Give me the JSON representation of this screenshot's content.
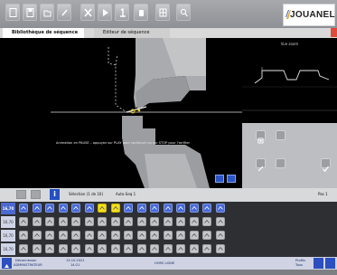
{
  "toolbar": {
    "buttons": [
      {
        "name": "file-icon"
      },
      {
        "name": "save-icon"
      },
      {
        "name": "folder-icon"
      },
      {
        "name": "edit-icon"
      },
      {
        "name": "delete-icon"
      },
      {
        "name": "play-icon"
      },
      {
        "name": "step-icon"
      },
      {
        "name": "hand-icon"
      },
      {
        "name": "table-icon"
      },
      {
        "name": "zoom-icon"
      }
    ],
    "brand": "JOUANEL"
  },
  "tabs": [
    {
      "label": "Bibliothèque de séquence"
    },
    {
      "label": "Editeur de séquence"
    }
  ],
  "zoom_panel": {
    "title": "Vue zoom"
  },
  "status_message": "Animation en PAUSE – appuyez sur PLAY pour continuer ou sur STOP pour l'arrêter",
  "selection_bar": {
    "selection": "Sélection (1 de 16)",
    "program": "Auto-Seq 1",
    "page": "Pas 1"
  },
  "grid": {
    "rows": [
      {
        "label": "16,70",
        "active": true
      },
      {
        "label": "16,70",
        "active": false
      },
      {
        "label": "16,70",
        "active": false
      },
      {
        "label": "16,70",
        "active": false
      }
    ],
    "highlighted": [
      6,
      7
    ]
  },
  "status_bar": {
    "logout_label": "Déconnexion",
    "role": "ADMINISTRATEUR",
    "date": "13.10.2021",
    "time": "14:21",
    "connection": "HORS LIGNE",
    "profile": "Profils",
    "profile_sub": "Tous"
  },
  "colors": {
    "accent": "#2a56c7",
    "highlight": "#f5e020",
    "close": "#e04a3a"
  }
}
